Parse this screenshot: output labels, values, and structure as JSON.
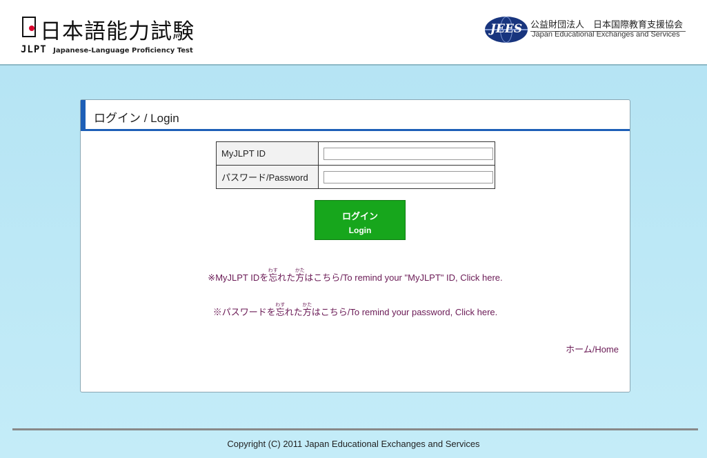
{
  "header": {
    "logo_kanji": "日本語能力試験",
    "logo_abbr": "JLPT",
    "logo_full": "Japanese-Language Proficiency Test",
    "jees_mark": "JEES",
    "jees_name_jp": "公益財団法人　日本国際教育支援協会",
    "jees_name_en": "Japan Educational Exchanges and Services"
  },
  "panel": {
    "title": "ログイン / Login",
    "id_label": "MyJLPT ID",
    "id_value": "",
    "password_label": "パスワード/Password",
    "password_value": "",
    "login_button_jp": "ログイン",
    "login_button_en": "Login",
    "remind_id": {
      "before": "※MyJLPT IDを",
      "wasu": "忘",
      "wasu_reading": "わす",
      "mid": "れた",
      "kata": "方",
      "kata_reading": "かた",
      "after": "はこちら/To remind your \"MyJLPT\" ID, Click here."
    },
    "remind_password": {
      "before": "※パスワードを",
      "wasu": "忘",
      "wasu_reading": "わす",
      "mid": "れた",
      "kata": "方",
      "kata_reading": "かた",
      "after": "はこちら/To remind your password, Click here."
    },
    "home_link": "ホーム/Home"
  },
  "footer": {
    "copyright": "Copyright (C) 2011  Japan Educational Exchanges and Services"
  },
  "colors": {
    "accent_blue": "#1d5fb7",
    "login_green": "#17a61c",
    "link_plum": "#6a1a55",
    "background_sky": "#b3e3f3"
  }
}
